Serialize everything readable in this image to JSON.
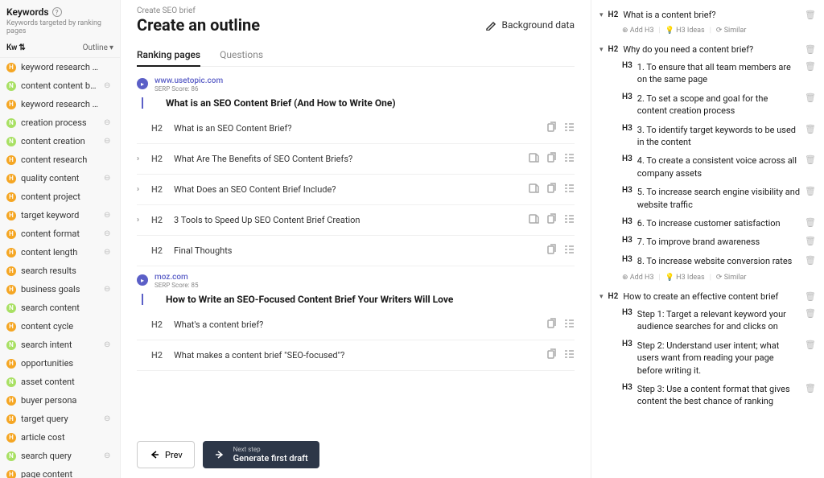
{
  "sidebar": {
    "title": "Keywords",
    "subtitle": "Keywords targeted by ranking pages",
    "tab_left": "Kw",
    "tab_right": "Outline",
    "items": [
      {
        "dot": "h",
        "text": "keyword research process",
        "x": false
      },
      {
        "dot": "n",
        "text": "content content briefs",
        "x": true
      },
      {
        "dot": "h",
        "text": "keyword research guide",
        "x": false
      },
      {
        "dot": "n",
        "text": "creation process",
        "x": true
      },
      {
        "dot": "n",
        "text": "content creation",
        "x": true
      },
      {
        "dot": "h",
        "text": "content research",
        "x": false
      },
      {
        "dot": "h",
        "text": "quality content",
        "x": true
      },
      {
        "dot": "h",
        "text": "content project",
        "x": false
      },
      {
        "dot": "h",
        "text": "target keyword",
        "x": true
      },
      {
        "dot": "h",
        "text": "content format",
        "x": true
      },
      {
        "dot": "h",
        "text": "content length",
        "x": true
      },
      {
        "dot": "h",
        "text": "search results",
        "x": false
      },
      {
        "dot": "h",
        "text": "business goals",
        "x": true
      },
      {
        "dot": "n",
        "text": "search content",
        "x": false
      },
      {
        "dot": "h",
        "text": "content cycle",
        "x": false
      },
      {
        "dot": "n",
        "text": "search intent",
        "x": true
      },
      {
        "dot": "h",
        "text": "opportunities",
        "x": false
      },
      {
        "dot": "n",
        "text": "asset content",
        "x": false
      },
      {
        "dot": "h",
        "text": "buyer persona",
        "x": false
      },
      {
        "dot": "h",
        "text": "target query",
        "x": true
      },
      {
        "dot": "h",
        "text": "article cost",
        "x": false
      },
      {
        "dot": "n",
        "text": "search query",
        "x": true
      },
      {
        "dot": "h",
        "text": "page content",
        "x": false
      }
    ]
  },
  "main": {
    "breadcrumb": "Create SEO brief",
    "title": "Create an outline",
    "bg_data": "Background data",
    "tabs": [
      "Ranking pages",
      "Questions"
    ],
    "serps": [
      {
        "url": "www.usetopic.com",
        "score": "SERP Score: 86",
        "article": "What is an SEO Content Brief (And How to Write One)",
        "rows": [
          {
            "chev": false,
            "tag": "H2",
            "text": "What is an SEO Content Brief?",
            "icons": [
              "copy",
              "outline"
            ]
          },
          {
            "chev": true,
            "tag": "H2",
            "text": "What Are The Benefits of SEO Content Briefs?",
            "icons": [
              "doc",
              "copy",
              "outline"
            ]
          },
          {
            "chev": true,
            "tag": "H2",
            "text": "What Does an SEO Content Brief Include?",
            "icons": [
              "doc",
              "copy",
              "outline"
            ]
          },
          {
            "chev": true,
            "tag": "H2",
            "text": "3 Tools to Speed Up SEO Content Brief Creation",
            "icons": [
              "doc",
              "copy",
              "outline"
            ]
          },
          {
            "chev": false,
            "tag": "H2",
            "text": "Final Thoughts",
            "icons": [
              "copy",
              "outline"
            ]
          }
        ]
      },
      {
        "url": "moz.com",
        "score": "SERP Score: 85",
        "article": "How to Write an SEO-Focused Content Brief Your Writers Will Love",
        "rows": [
          {
            "chev": false,
            "tag": "H2",
            "text": "What's a content brief?",
            "icons": [
              "copy",
              "outline"
            ]
          },
          {
            "chev": false,
            "tag": "H2",
            "text": "What makes a content brief \"SEO-focused\"?",
            "icons": [
              "copy",
              "outline"
            ]
          }
        ]
      }
    ],
    "prev": "Prev",
    "next_sub": "Next step",
    "next_label": "Generate first draft"
  },
  "outline": {
    "actions": {
      "add": "Add H3",
      "ideas": "H3 Ideas",
      "similar": "Similar"
    },
    "sections": [
      {
        "h2": "What is a content brief?",
        "h3": [],
        "showActions": true
      },
      {
        "h2": "Why do you need a content brief?",
        "h3": [
          "1. To ensure that all team members are on the same page",
          "2. To set a scope and goal for the content creation process",
          "3. To identify target keywords to be used in the content",
          "4. To create a consistent voice across all company assets",
          "5. To increase search engine visibility and website traffic",
          "6. To increase customer satisfaction",
          "7. To improve brand awareness",
          "8. To increase website conversion rates"
        ],
        "showActions": true
      },
      {
        "h2": "How to create an effective content brief",
        "h3": [
          "Step 1: Target a relevant keyword your audience searches for and clicks on",
          "Step 2: Understand user intent; what users want from reading your page before writing it.",
          "Step 3: Use a content format that gives content the best chance of ranking"
        ],
        "showActions": false
      }
    ]
  }
}
